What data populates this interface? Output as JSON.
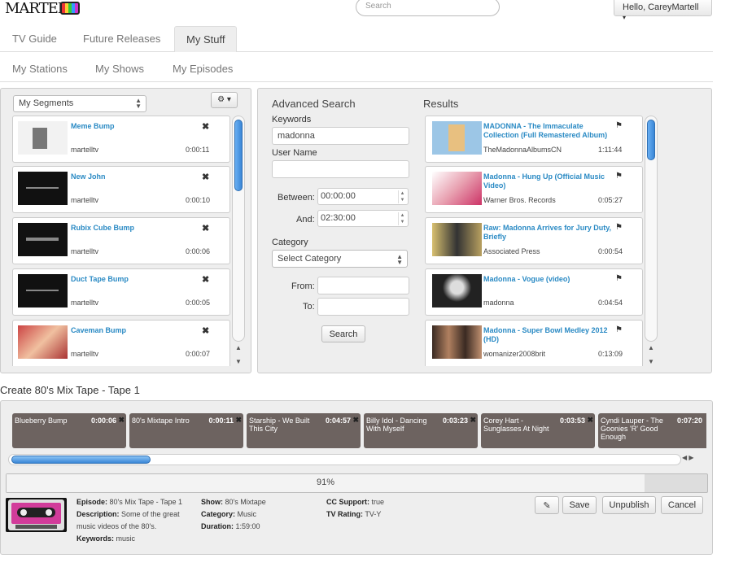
{
  "header": {
    "logo_text": "MARTELL",
    "search_placeholder": "Search",
    "user_menu": "Hello, CareyMartell"
  },
  "tabs": [
    {
      "label": "TV Guide",
      "active": false
    },
    {
      "label": "Future Releases",
      "active": false
    },
    {
      "label": "My Stuff",
      "active": true
    }
  ],
  "subtabs": [
    "My Stations",
    "My Shows",
    "My Episodes"
  ],
  "segments": {
    "select_value": "My Segments",
    "items": [
      {
        "title": "Meme Bump",
        "user": "martelltv",
        "duration": "0:00:11",
        "thumb": "#f2f2f2"
      },
      {
        "title": "New John",
        "user": "martelltv",
        "duration": "0:00:10",
        "thumb": "#050505"
      },
      {
        "title": "Rubix Cube Bump",
        "user": "martelltv",
        "duration": "0:00:06",
        "thumb": "#050505"
      },
      {
        "title": "Duct Tape Bump",
        "user": "martelltv",
        "duration": "0:00:05",
        "thumb": "#050505"
      },
      {
        "title": "Caveman Bump",
        "user": "martelltv",
        "duration": "0:00:07",
        "thumb": "#c44"
      }
    ]
  },
  "advanced_search": {
    "title": "Advanced Search",
    "keywords_label": "Keywords",
    "keywords_value": "madonna",
    "username_label": "User Name",
    "username_value": "",
    "between_label": "Between:",
    "between_value": "00:00:00",
    "and_label": "And:",
    "and_value": "02:30:00",
    "category_label": "Category",
    "category_value": "Select Category",
    "from_label": "From:",
    "to_label": "To:",
    "search_button": "Search"
  },
  "results": {
    "title": "Results",
    "items": [
      {
        "title": "MADONNA - The Immaculate Collection (Full Remastered Album)",
        "user": "TheMadonnaAlbumsCN",
        "duration": "1:11:44",
        "thumb": "#9cc6e6"
      },
      {
        "title": "Madonna - Hung Up (Official Music Video)",
        "user": "Warner Bros. Records",
        "duration": "0:05:27",
        "thumb": "#e8a0b0"
      },
      {
        "title": "Raw: Madonna Arrives for Jury Duty, Briefly",
        "user": "Associated Press",
        "duration": "0:00:54",
        "thumb": "#8a7a4a"
      },
      {
        "title": "Madonna - Vogue (video)",
        "user": "madonna",
        "duration": "0:04:54",
        "thumb": "#222"
      },
      {
        "title": "Madonna - Super Bowl Medley 2012 (HD)",
        "user": "womanizer2008brit",
        "duration": "0:13:09",
        "thumb": "#6a4a3a"
      }
    ]
  },
  "mixtape": {
    "title": "Create 80's Mix Tape - Tape 1",
    "tracks": [
      {
        "name": "Blueberry Bump",
        "duration": "0:00:06"
      },
      {
        "name": "80's Mixtape Intro",
        "duration": "0:00:11"
      },
      {
        "name": "Starship - We Built This City",
        "duration": "0:04:57"
      },
      {
        "name": "Billy Idol - Dancing With Myself",
        "duration": "0:03:23"
      },
      {
        "name": "Corey Hart - Sunglasses At Night",
        "duration": "0:03:53"
      },
      {
        "name": "Cyndi Lauper - The Goonies 'R' Good Enough",
        "duration": "0:07:20"
      }
    ],
    "progress_text": "91%",
    "progress_value": 0.91
  },
  "episode": {
    "episode_label": "Episode:",
    "episode_value": "80's Mix Tape - Tape 1",
    "description_label": "Description:",
    "description_line1": "Some of the great",
    "description_line2": "music videos of the 80's.",
    "keywords_label": "Keywords:",
    "keywords_value": "music",
    "show_label": "Show:",
    "show_value": "80's Mixtape",
    "category_label": "Category:",
    "category_value": "Music",
    "duration_label": "Duration:",
    "duration_value": "1:59:00",
    "cc_label": "CC Support:",
    "cc_value": "true",
    "rating_label": "TV Rating:",
    "rating_value": "TV-Y"
  },
  "actions": {
    "save": "Save",
    "unpublish": "Unpublish",
    "cancel": "Cancel"
  },
  "colors": {
    "accent": "#2a8ac4",
    "track_bg": "#6d6360"
  }
}
